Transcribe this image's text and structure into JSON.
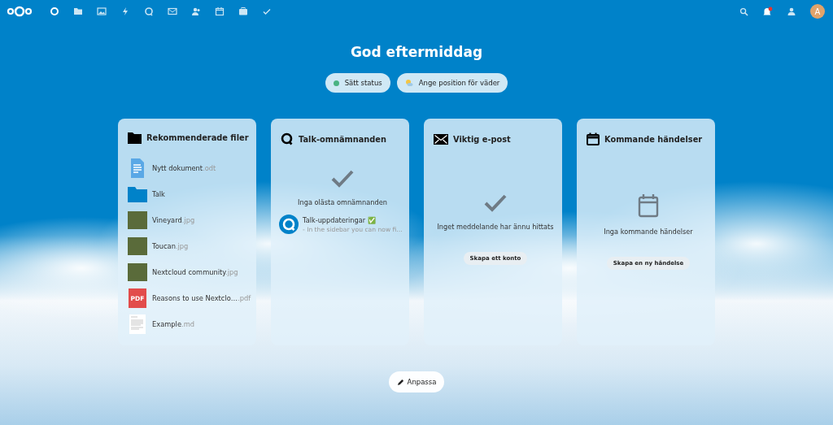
{
  "header": {
    "avatar_initial": "A"
  },
  "greeting": "God eftermiddag",
  "status_buttons": [
    {
      "kind": "status",
      "label": "Sätt status",
      "color": "#49b382"
    },
    {
      "kind": "weather",
      "label": "Ange position för väder"
    }
  ],
  "widgets": [
    {
      "kind": "files",
      "title": "Rekommenderade filer",
      "items": [
        {
          "kind": "document",
          "name": "Nytt dokument",
          "ext": ".odt"
        },
        {
          "kind": "folder",
          "name": "Talk"
        },
        {
          "kind": "photo",
          "name": "Vineyard",
          "ext": ".jpg"
        },
        {
          "kind": "photo",
          "name": "Toucan",
          "ext": ".jpg"
        },
        {
          "kind": "photo",
          "name": "Nextcloud community",
          "ext": ".jpg"
        },
        {
          "kind": "pdf",
          "name": "Reasons to use Nextclo…",
          "ext": ".pdf",
          "badge": "PDF"
        },
        {
          "kind": "text",
          "name": "Example",
          "ext": ".md"
        }
      ]
    },
    {
      "kind": "talk",
      "title": "Talk-omnämnanden",
      "empty_text": "Inga olästa omnämnanden",
      "items": [
        {
          "title": "Talk-uppdateringar ✅",
          "subtitle": "- In the sidebar you can now fi…"
        }
      ]
    },
    {
      "kind": "mail",
      "title": "Viktig e-post",
      "empty_text": "Inget meddelande har ännu hittats",
      "action": "Skapa ett konto"
    },
    {
      "kind": "calendar",
      "title": "Kommande händelser",
      "empty_text": "Inga kommande händelser",
      "action": "Skapa en ny händelse"
    }
  ],
  "customize_button": "Anpassa"
}
